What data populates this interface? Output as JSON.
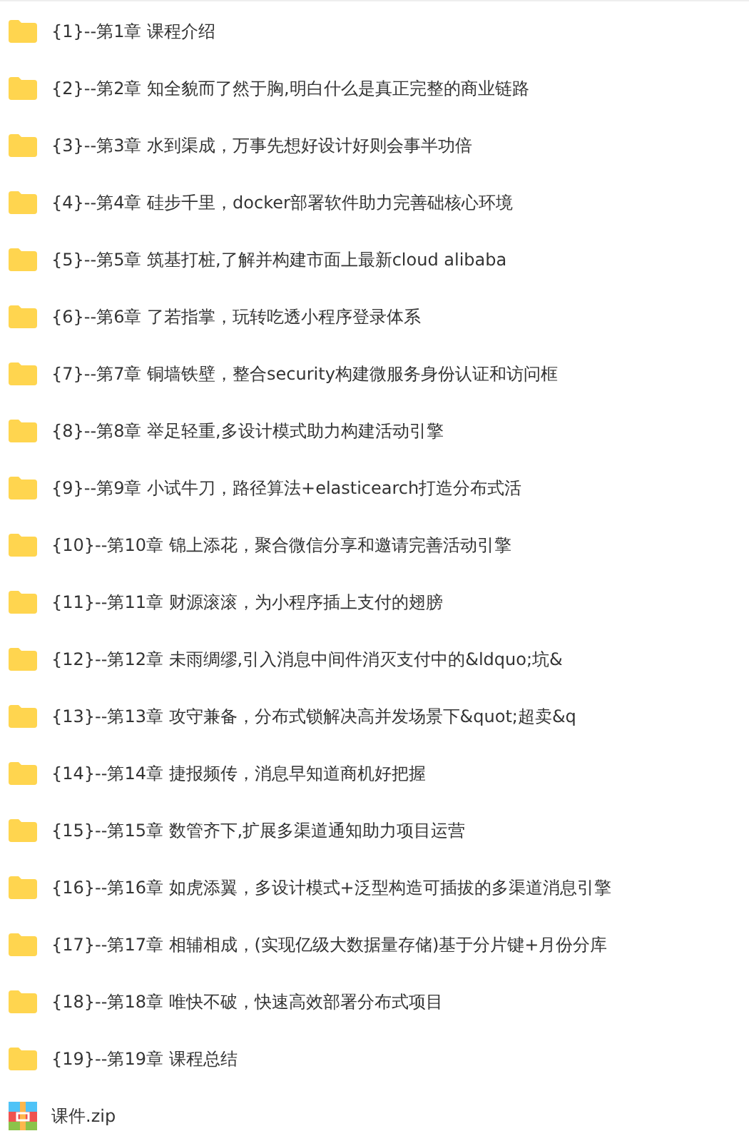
{
  "files": [
    {
      "kind": "folder",
      "name": "{1}--第1章 课程介绍"
    },
    {
      "kind": "folder",
      "name": "{2}--第2章 知全貌而了然于胸,明白什么是真正完整的商业链路"
    },
    {
      "kind": "folder",
      "name": "{3}--第3章 水到渠成，万事先想好设计好则会事半功倍"
    },
    {
      "kind": "folder",
      "name": "{4}--第4章 硅步千里，docker部署软件助力完善础核心环境"
    },
    {
      "kind": "folder",
      "name": "{5}--第5章 筑基打桩,了解并构建市面上最新cloud alibaba"
    },
    {
      "kind": "folder",
      "name": "{6}--第6章 了若指掌，玩转吃透小程序登录体系"
    },
    {
      "kind": "folder",
      "name": "{7}--第7章 铜墙铁壁，整合security构建微服务身份认证和访问框"
    },
    {
      "kind": "folder",
      "name": "{8}--第8章 举足轻重,多设计模式助力构建活动引擎"
    },
    {
      "kind": "folder",
      "name": "{9}--第9章 小试牛刀，路径算法+elasticearch打造分布式活"
    },
    {
      "kind": "folder",
      "name": "{10}--第10章 锦上添花，聚合微信分享和邀请完善活动引擎"
    },
    {
      "kind": "folder",
      "name": "{11}--第11章 财源滚滚，为小程序插上支付的翅膀"
    },
    {
      "kind": "folder",
      "name": "{12}--第12章 未雨绸缪,引入消息中间件消灭支付中的&ldquo;坑&"
    },
    {
      "kind": "folder",
      "name": "{13}--第13章 攻守兼备，分布式锁解决高并发场景下&quot;超卖&q"
    },
    {
      "kind": "folder",
      "name": "{14}--第14章 捷报频传，消息早知道商机好把握"
    },
    {
      "kind": "folder",
      "name": "{15}--第15章 数管齐下,扩展多渠道通知助力项目运营"
    },
    {
      "kind": "folder",
      "name": "{16}--第16章 如虎添翼，多设计模式+泛型构造可插拔的多渠道消息引擎"
    },
    {
      "kind": "folder",
      "name": "{17}--第17章 相辅相成，(实现亿级大数据量存储)基于分片键+月份分库"
    },
    {
      "kind": "folder",
      "name": "{18}--第18章 唯快不破，快速高效部署分布式项目"
    },
    {
      "kind": "folder",
      "name": "{19}--第19章 课程总结"
    },
    {
      "kind": "archive",
      "name": "课件.zip"
    }
  ]
}
